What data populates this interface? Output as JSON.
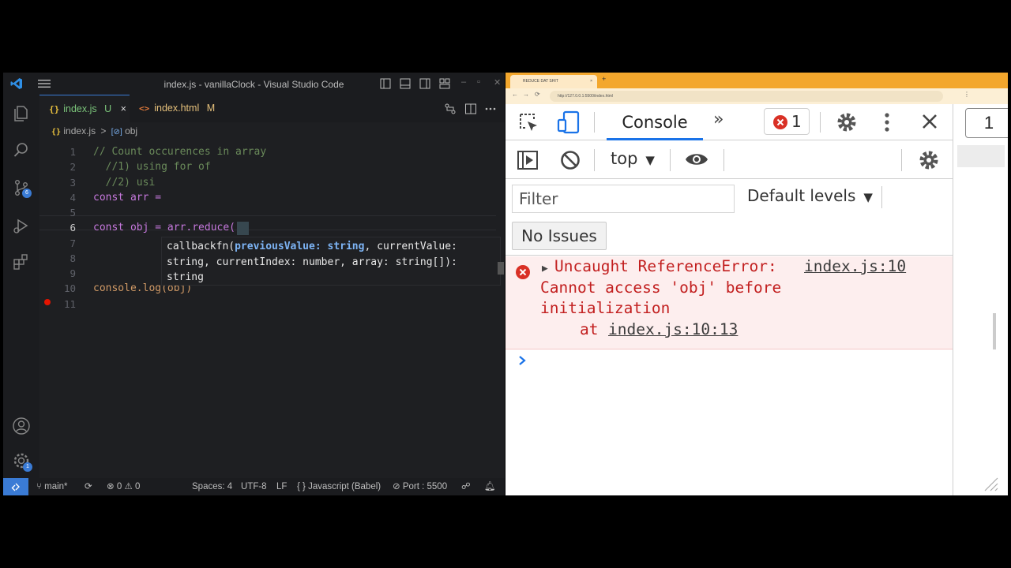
{
  "vscode": {
    "window_title": "index.js - vanillaClock - Visual Studio Code",
    "tabs": [
      {
        "icon_text": "{}",
        "label": "index.js",
        "status": "U",
        "close": "×"
      },
      {
        "icon_text": "<>",
        "label": "index.html",
        "status": "M"
      }
    ],
    "breadcrumb": {
      "file": "index.js",
      "sep": ">",
      "symbol": "obj"
    },
    "activity_badges": {
      "source_control": "6",
      "settings": "1"
    },
    "code_lines": [
      {
        "num": "1",
        "text": "// Count occurences in array"
      },
      {
        "num": "2",
        "text": "  //1) using for of"
      },
      {
        "num": "3",
        "text": "  //2) usi"
      },
      {
        "num": "4",
        "text": "const arr ="
      },
      {
        "num": "5",
        "text": ""
      },
      {
        "num": "6",
        "text": "const obj = arr.reduce( )"
      },
      {
        "num": "7",
        "text": ""
      },
      {
        "num": "8",
        "text": ""
      },
      {
        "num": "9",
        "text": ""
      },
      {
        "num": "10",
        "text": "console.log(obj)"
      },
      {
        "num": "11",
        "text": ""
      }
    ],
    "tooltip": {
      "line1_a": "callbackfn(",
      "line1_b": "previousValue: string",
      "line1_c": ", currentValue:",
      "line2": "string, currentIndex: number, array: string[]):",
      "line3": "string"
    },
    "status": {
      "branch": "main*",
      "errors": "0",
      "warnings": "0",
      "spaces": "Spaces: 4",
      "encoding": "UTF-8",
      "eol": "LF",
      "language": "Javascript (Babel)",
      "port": "Port : 5500"
    }
  },
  "browser": {
    "tab_title": "REDUCE DAT SHIT",
    "url": "http://127.0.0.1:5500/index.html",
    "devtools": {
      "tab": "Console",
      "more": "»",
      "error_count": "1",
      "context": "top",
      "filter_placeholder": "Filter",
      "levels": "Default levels",
      "issues": "No Issues",
      "error": {
        "line1": "Uncaught ReferenceError:",
        "link1": "index.js:10",
        "line2": "Cannot access 'obj' before",
        "line3": "initialization",
        "at": "at",
        "link2": "index.js:10:13"
      }
    },
    "page_number": "1"
  },
  "colors": {
    "accent": "#1a73e8",
    "error": "#c21f1f",
    "vscode_blue": "#3a7bd5"
  }
}
